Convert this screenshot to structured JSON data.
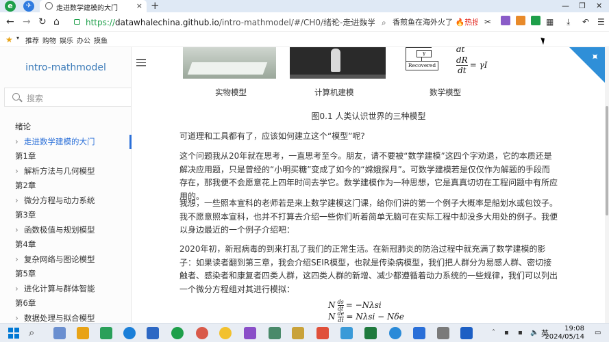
{
  "browser": {
    "tab_title": "走进数学建模的大门",
    "tab_close": "×",
    "new_tab": "+",
    "win_min": "—",
    "win_restore": "❐",
    "win_close": "✕",
    "url_scheme": "https://",
    "url_host": "datawhalechina.github.io",
    "url_path": "/intro-mathmodel/#/CH0/绪论-走进数学",
    "search_text": "香煎鱼在海外火了",
    "hot_label": "🔥热搜",
    "nav_back": "←",
    "nav_forward": "→",
    "nav_refresh": "↻",
    "nav_home": "⌂",
    "more": "···",
    "dropdown": "⌄"
  },
  "bookmarks": {
    "star": "★",
    "items": [
      "推荐",
      "购物",
      "娱乐",
      "办公",
      "摸鱼"
    ]
  },
  "sidebar": {
    "title": "intro-mathmodel",
    "search_placeholder": "搜索",
    "items": [
      {
        "label": "绪论",
        "sub": false,
        "active": false
      },
      {
        "label": "走进数学建模的大门",
        "sub": true,
        "active": true
      },
      {
        "label": "第1章",
        "sub": false,
        "active": false
      },
      {
        "label": "解析方法与几何模型",
        "sub": true,
        "active": false
      },
      {
        "label": "第2章",
        "sub": false,
        "active": false
      },
      {
        "label": "微分方程与动力系统",
        "sub": true,
        "active": false
      },
      {
        "label": "第3章",
        "sub": false,
        "active": false
      },
      {
        "label": "函数极值与规划模型",
        "sub": true,
        "active": false
      },
      {
        "label": "第4章",
        "sub": false,
        "active": false
      },
      {
        "label": "复杂网络与图论模型",
        "sub": true,
        "active": false
      },
      {
        "label": "第5章",
        "sub": false,
        "active": false
      },
      {
        "label": "进化计算与群体智能",
        "sub": true,
        "active": false
      },
      {
        "label": "第6章",
        "sub": false,
        "active": false
      },
      {
        "label": "数据处理与拟合模型",
        "sub": true,
        "active": false
      }
    ]
  },
  "content": {
    "diagram_box_top": "γ",
    "diagram_box": "Recovered",
    "eq_top": "dt",
    "eq_num": "dR",
    "eq_den": "dt",
    "eq_rhs": "= γI",
    "captions": [
      "实物模型",
      "计算机建模",
      "数学模型"
    ],
    "figure_caption": "图0.1 人类认识世界的三种模型",
    "paragraphs": [
      "可道理和工具都有了，应该如何建立这个“模型”呢?",
      "这个问题我从20年就在思考，一直思考至今。朋友，请不要被“数学建模”这四个字劝退，它的本质还是解决应用题，只是曾经的“小明买糖”变成了如今的“嫦娥探月”。可数学建模若是仅仅作为解题的手段而存在，那我便不会愿意花上四年时间去学它。数学建模作为一种思想，它是真真切切在工程问题中有所应用的。",
      "我想，一些照本宣科的老师若是来上数学建模这门课，给你们讲的第一个例子大概率是船划水或包饺子。我不愿意照本宣科，也并不打算去介绍一些你们听着简单无脑可在实际工程中却没多大用处的例子。我便以身边最近的一个例子介绍吧：",
      "2020年初，新冠病毒的到来打乱了我们的正常生活。在新冠肺炎的防治过程中就充满了数学建模的影子：如果读者翻到第三章，我会介绍SEIR模型，也就是传染病模型，我们把人群分为易感人群、密切接触者、感染者和康复者四类人群，这四类人群的新增、减少都遵循着动力系统的一些规律，我们可以列出一个微分方程组对其进行模拟："
    ],
    "formula1_lhs": "N",
    "formula1_num": "ds",
    "formula1_den": "dt",
    "formula1_rhs": "= −Nλsi",
    "formula2_lhs": "N",
    "formula2_num": "de",
    "formula2_den": "dt",
    "formula2_rhs": "= Nλsi − Nδe"
  },
  "taskbar": {
    "lang": "英",
    "time": "19:08",
    "date": "2024/05/14"
  }
}
